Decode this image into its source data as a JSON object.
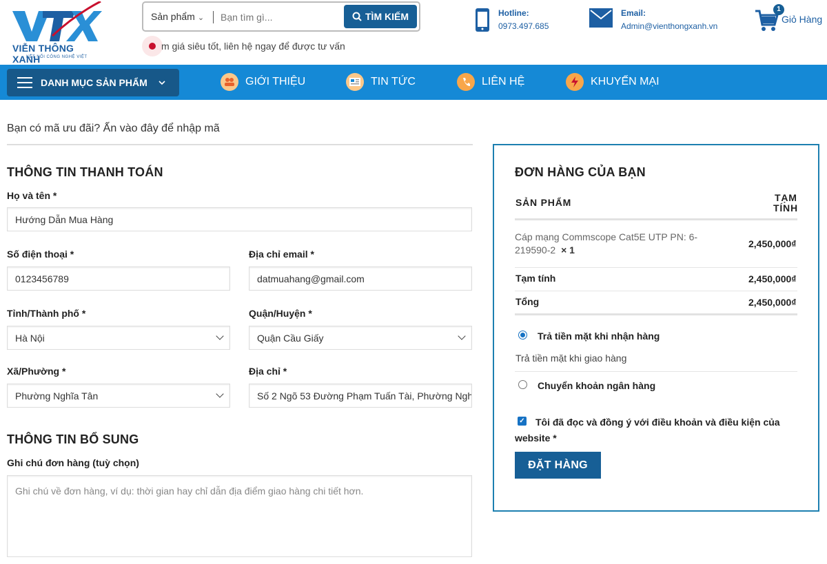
{
  "brand": {
    "logo_mark": "VTX",
    "name": "VIỄN THÔNG XANH",
    "tagline": "KẾT NỐI CÔNG NGHỆ VIỆT"
  },
  "search": {
    "category": "Sản phẩm",
    "placeholder": "Bạn tìm gì...",
    "button_label": "TÌM KIẾM"
  },
  "promo": {
    "text": "m giá siêu tốt, liên hệ ngay để được tư vấn"
  },
  "contacts": {
    "hotline_label": "Hotline:",
    "hotline_value": "0973.497.685",
    "email_label": "Email:",
    "email_value": "Admin@vienthongxanh.vn"
  },
  "cart": {
    "count": "1",
    "label": "Giỏ Hàng"
  },
  "nav": {
    "menu_label": "DANH MỤC SẢN PHẨM",
    "items": [
      {
        "label": "GIỚI THIỆU"
      },
      {
        "label": "TIN TỨC"
      },
      {
        "label": "LIÊN HỆ"
      },
      {
        "label": "KHUYẾN MẠI"
      }
    ]
  },
  "checkout": {
    "coupon_text": "Bạn có mã ưu đãi? Ấn vào đây để nhập mã",
    "billing_title": "THÔNG TIN THANH TOÁN",
    "fields": {
      "name_label": "Họ và tên *",
      "name_value": "Hướng Dẫn Mua Hàng",
      "phone_label": "Số điện thoại *",
      "phone_value": "0123456789",
      "email_label": "Địa chỉ email *",
      "email_value": "datmuahang@gmail.com",
      "province_label": "Tỉnh/Thành phố *",
      "province_value": "Hà Nội",
      "district_label": "Quận/Huyện *",
      "district_value": "Quận Cầu Giấy",
      "ward_label": "Xã/Phường *",
      "ward_value": "Phường Nghĩa Tân",
      "address_label": "Địa chỉ *",
      "address_value": "Số 2 Ngõ 53 Đường Phạm Tuấn Tài, Phường Nghĩa Tân"
    },
    "extra_title": "THÔNG TIN BỔ SUNG",
    "notes_label": "Ghi chú đơn hàng (tuỳ chọn)",
    "notes_placeholder": "Ghi chú về đơn hàng, ví dụ: thời gian hay chỉ dẫn địa điểm giao hàng chi tiết hơn."
  },
  "order": {
    "title": "ĐƠN HÀNG CỦA BẠN",
    "col_product": "SẢN PHẨM",
    "col_subtotal_1": "TẠM",
    "col_subtotal_2": "TÍNH",
    "item_name_1": "Cáp mạng Commscope Cat5E UTP PN: 6-",
    "item_name_2": "219590-2",
    "item_qty": "× 1",
    "item_price": "2,450,000₫",
    "subtotal_label": "Tạm tính",
    "subtotal_value": "2,450,000₫",
    "total_label": "Tổng",
    "total_value": "2,450,000₫",
    "pay_cod_label": "Trả tiền mặt khi nhận hàng",
    "pay_cod_desc": "Trả tiền mặt khi giao hàng",
    "pay_bank_label": "Chuyển khoản ngân hàng",
    "terms_1": "Tôi đã đọc và đồng ý với điều khoản và điều kiện của",
    "terms_2": "website",
    "terms_req": "*",
    "submit_label": "ĐẶT HÀNG"
  },
  "colors": {
    "primary": "#175f96",
    "nav_bg": "#1589d6",
    "border_accent": "#1c7fb0"
  }
}
